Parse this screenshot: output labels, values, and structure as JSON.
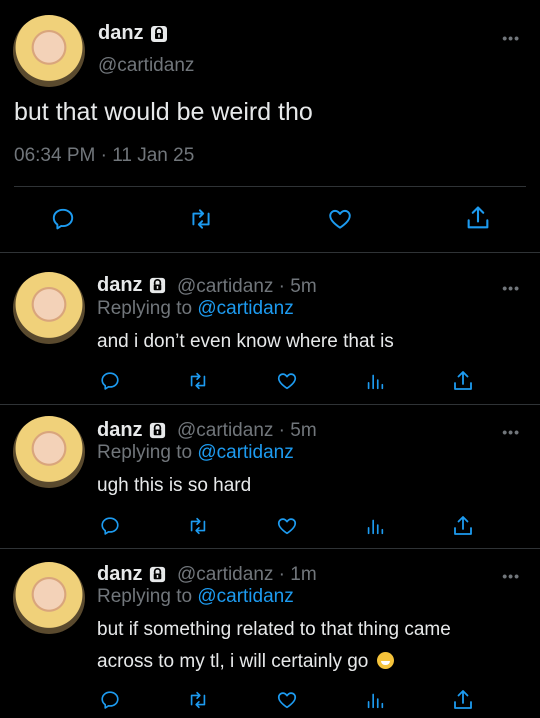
{
  "main_tweet": {
    "name": "danz",
    "handle": "@cartidanz",
    "text": "but that would be weird tho",
    "timestamp": "06:34 PM · 11 Jan 25",
    "more": "•••"
  },
  "replies": [
    {
      "name": "danz",
      "handle_time": "@cartidanz · 5m",
      "replying_prefix": "Replying to ",
      "replying_to": "@cartidanz",
      "text": "and i don’t even know where that is",
      "more": "•••"
    },
    {
      "name": "danz",
      "handle_time": "@cartidanz · 5m",
      "replying_prefix": "Replying to ",
      "replying_to": "@cartidanz",
      "text": "ugh this is so hard",
      "more": "•••"
    },
    {
      "name": "danz",
      "handle_time": "@cartidanz · 1m",
      "replying_prefix": "Replying to ",
      "replying_to": "@cartidanz",
      "text_line1": "but if something related to that thing came",
      "text_line2": "across to my tl, i will certainly go",
      "emoji": "grinning-face-emoji",
      "more": "•••"
    }
  ],
  "icons": {
    "reply": "reply-icon",
    "retweet": "retweet-icon",
    "like": "heart-icon",
    "views": "views-icon",
    "share": "share-icon",
    "lock": "lock-icon"
  }
}
